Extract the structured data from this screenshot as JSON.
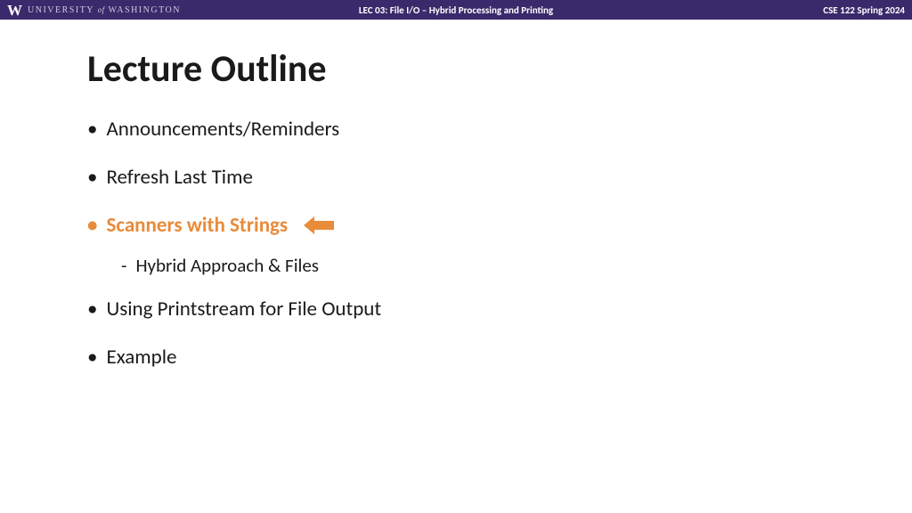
{
  "header": {
    "university_prefix": "UNIVERSITY",
    "university_of": "of",
    "university_name": "WASHINGTON",
    "lecture_label": "LEC 03: File I/O – Hybrid Processing and Printing",
    "course_label": "CSE 122 Spring 2024"
  },
  "title": "Lecture Outline",
  "bullets": {
    "item0": "Announcements/Reminders",
    "item1": "Refresh Last Time",
    "item2": "Scanners with Strings",
    "item2_sub0": "Hybrid Approach & Files",
    "item3": "Using Printstream for File Output",
    "item4": "Example"
  },
  "colors": {
    "header_bg": "#3a2a6b",
    "highlight": "#e88b3a"
  }
}
